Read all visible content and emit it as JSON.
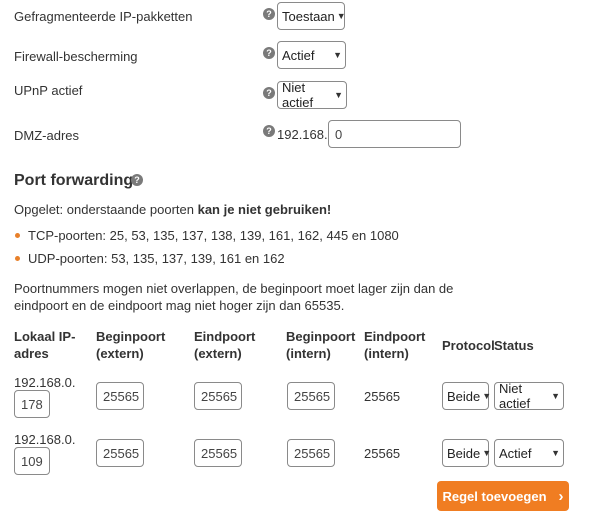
{
  "settings": {
    "fragmented_label": "Gefragmenteerde IP-pakketten",
    "fragmented_value": "Toestaan",
    "firewall_label": "Firewall-bescherming",
    "firewall_value": "Actief",
    "upnp_label": "UPnP actief",
    "upnp_value": "Niet actief",
    "dmz_label": "DMZ-adres",
    "dmz_prefix": "192.168.0.",
    "dmz_value": "0"
  },
  "port_forwarding": {
    "title": "Port forwarding",
    "warning_prefix": "Opgelet: onderstaande poorten ",
    "warning_bold": "kan je niet gebruiken!",
    "tcp_ports": "TCP-poorten: 25, 53, 135, 137, 138, 139, 161, 162, 445 en 1080",
    "udp_ports": "UDP-poorten: 53, 135, 137, 139, 161 en 162",
    "note_line1": "Poortnummers mogen niet overlappen, de beginpoort moet lager zijn dan de",
    "note_line2": "eindpoort en de eindpoort mag niet hoger zijn dan 65535."
  },
  "table": {
    "headers": {
      "local_ip_1": "Lokaal IP-",
      "local_ip_2": "adres",
      "begin_ext_1": "Beginpoort",
      "begin_ext_2": "(extern)",
      "end_ext_1": "Eindpoort",
      "end_ext_2": "(extern)",
      "begin_int_1": "Beginpoort",
      "begin_int_2": "(intern)",
      "end_int_1": "Eindpoort",
      "end_int_2": "(intern)",
      "protocol": "Protocol",
      "status": "Status"
    },
    "rows": [
      {
        "ip_prefix": "192.168.0.",
        "ip_suffix": "178",
        "begin_ext": "25565",
        "end_ext": "25565",
        "begin_int": "25565",
        "end_int": "25565",
        "protocol": "Beide",
        "status": "Niet actief"
      },
      {
        "ip_prefix": "192.168.0.",
        "ip_suffix": "109",
        "begin_ext": "25565",
        "end_ext": "25565",
        "begin_int": "25565",
        "end_int": "25565",
        "protocol": "Beide",
        "status": "Actief"
      }
    ]
  },
  "add_rule_label": "Regel toevoegen",
  "colors": {
    "accent": "#f07d22",
    "help_icon": "#7a7a7a",
    "text": "#333333"
  }
}
